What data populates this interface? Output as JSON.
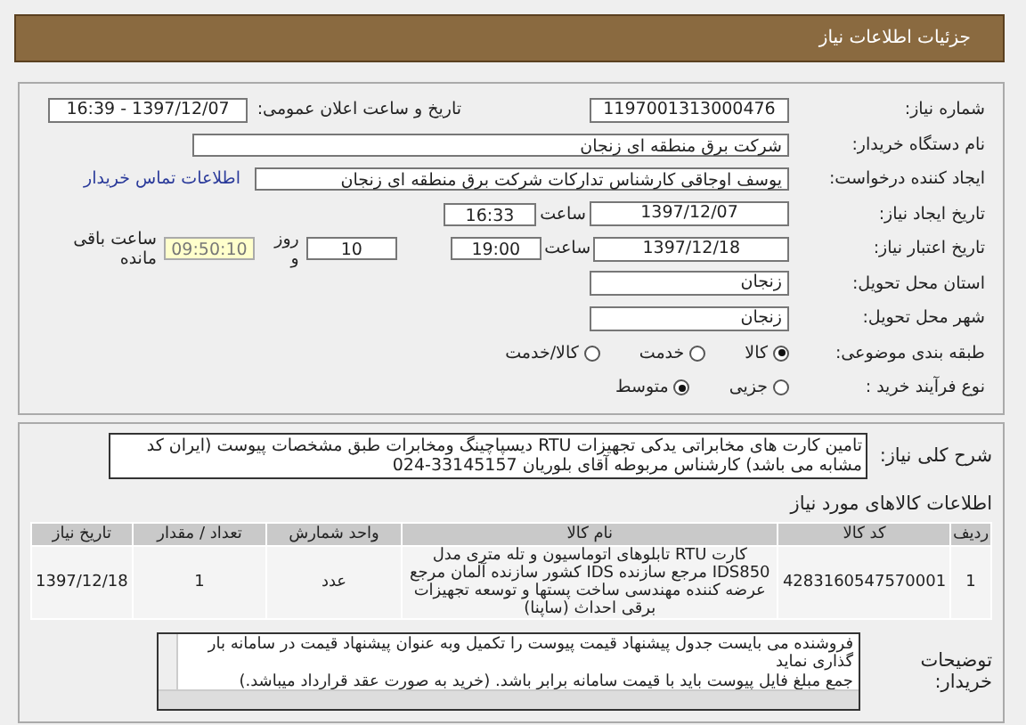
{
  "header": {
    "title": "جزئیات اطلاعات نیاز"
  },
  "need_number": {
    "label": "شماره نیاز:",
    "value": "1197001313000476"
  },
  "announce": {
    "label": "تاریخ و ساعت اعلان عمومی:",
    "value": "1397/12/07 - 16:39"
  },
  "buyer_org": {
    "label": "نام دستگاه خریدار:",
    "value": "شرکت برق منطقه ای زنجان"
  },
  "requester": {
    "label": "ایجاد کننده درخواست:",
    "value": "یوسف اوجاقی کارشناس تدارکات شرکت برق منطقه ای زنجان",
    "contact_link": "اطلاعات تماس خریدار"
  },
  "creation": {
    "label": "تاریخ ایجاد نیاز:",
    "date": "1397/12/07",
    "time_label": "ساعت",
    "time": "16:33"
  },
  "validity": {
    "label": "تاریخ اعتبار نیاز:",
    "date": "1397/12/18",
    "time_label": "ساعت",
    "time": "19:00",
    "days": "10",
    "days_label": "روز و",
    "remaining": "09:50:10",
    "remaining_label": "ساعت باقی مانده"
  },
  "province": {
    "label": "استان محل تحویل:",
    "value": "زنجان"
  },
  "city": {
    "label": "شهر محل تحویل:",
    "value": "زنجان"
  },
  "category": {
    "label": "طبقه بندی موضوعی:",
    "options": [
      {
        "label": "کالا",
        "selected": true
      },
      {
        "label": "خدمت",
        "selected": false
      },
      {
        "label": "کالا/خدمت",
        "selected": false
      }
    ]
  },
  "purchase_type": {
    "label": "نوع فرآیند خرید :",
    "options": [
      {
        "label": "جزیی",
        "selected": false
      },
      {
        "label": "متوسط",
        "selected": true
      }
    ]
  },
  "description": {
    "label": "شرح کلی نیاز:",
    "text": "تامین کارت های مخابراتی یدکی تجهیزات RTU دیسپاچینگ ومخابرات  طبق مشخصات پیوست (ایران کد مشابه می باشد) کارشناس مربوطه آقای بلوریان 33145157-024"
  },
  "goods_title": "اطلاعات کالاهای مورد نیاز",
  "table": {
    "columns": [
      "ردیف",
      "کد کالا",
      "نام کالا",
      "واحد شمارش",
      "تعداد / مقدار",
      "تاریخ نیاز"
    ],
    "rows": [
      [
        "1",
        "4283160547570001",
        "کارت RTU تابلوهای اتوماسیون و تله متری مدل IDS850 مرجع سازنده IDS کشور سازنده آلمان مرجع عرضه کننده مهندسی ساخت پستها و توسعه تجهیزات برقی احداث (ساپنا)",
        "عدد",
        "1",
        "1397/12/18"
      ]
    ]
  },
  "buyer_notes": {
    "label": "توضیحات خریدار:",
    "lines": [
      "فروشنده می بایست جدول پیشنهاد قیمت پیوست را تکمیل وبه عنوان پیشنهاد قیمت در سامانه بار گذاری نماید",
      "جمع مبلغ فایل پیوست باید با قیمت سامانه برابر باشد.  (خرید به صورت عقد قرارداد میباشد.)"
    ]
  }
}
